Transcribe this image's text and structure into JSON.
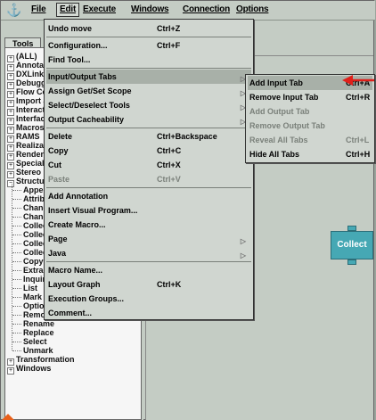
{
  "menubar": {
    "logo_icon": "anchor-icon",
    "items": [
      "File",
      "Edit",
      "Execute",
      "Windows",
      "Connection",
      "Options"
    ]
  },
  "left": {
    "tab": "Tools",
    "tree": [
      "(ALL)",
      "Annotation",
      "DXLink",
      "Debugging",
      "Flow Cont",
      "Import and",
      "Interactor",
      "Interface",
      "Macros",
      "RAMS",
      "Realization",
      "Rendering",
      "Special",
      "Stereo",
      "Structuring"
    ],
    "children": [
      "Append",
      "Attribute",
      "ChangeG",
      "ChangeG",
      "Collect",
      "CollectM",
      "CollectN",
      "CollectS",
      "CopyCon",
      "Extract",
      "Inquire",
      "List",
      "Mark",
      "Options",
      "Remove",
      "Rename",
      "Replace",
      "Select",
      "Unmark"
    ],
    "tree_bottom": [
      "Transformation",
      "Windows"
    ]
  },
  "edit_menu": {
    "items": [
      {
        "label": "Undo move",
        "acc": "Ctrl+Z"
      },
      {
        "label": "Configuration...",
        "acc": "Ctrl+F"
      },
      {
        "label": "Find Tool...",
        "acc": ""
      },
      {
        "label": "Input/Output Tabs",
        "acc": ""
      },
      {
        "label": "Assign Get/Set Scope",
        "acc": ""
      },
      {
        "label": "Select/Deselect Tools",
        "acc": ""
      },
      {
        "label": "Output Cacheability",
        "acc": ""
      },
      {
        "label": "Delete",
        "acc": "Ctrl+Backspace"
      },
      {
        "label": "Copy",
        "acc": "Ctrl+C"
      },
      {
        "label": "Cut",
        "acc": "Ctrl+X"
      },
      {
        "label": "Paste",
        "acc": "Ctrl+V"
      },
      {
        "label": "Add Annotation",
        "acc": ""
      },
      {
        "label": "Insert Visual Program...",
        "acc": ""
      },
      {
        "label": "Create Macro...",
        "acc": ""
      },
      {
        "label": "Page",
        "acc": ""
      },
      {
        "label": "Java",
        "acc": ""
      },
      {
        "label": "Macro Name...",
        "acc": ""
      },
      {
        "label": "Layout Graph",
        "acc": "Ctrl+K"
      },
      {
        "label": "Execution Groups...",
        "acc": ""
      },
      {
        "label": "Comment...",
        "acc": ""
      }
    ]
  },
  "submenu": {
    "items": [
      {
        "label": "Add Input Tab",
        "acc": "Ctrl+A"
      },
      {
        "label": "Remove Input Tab",
        "acc": "Ctrl+R"
      },
      {
        "label": "Add Output Tab",
        "acc": ""
      },
      {
        "label": "Remove Output Tab",
        "acc": ""
      },
      {
        "label": "Reveal All Tabs",
        "acc": "Ctrl+L"
      },
      {
        "label": "Hide All Tabs",
        "acc": "Ctrl+H"
      }
    ]
  },
  "canvas": {
    "node_label": "Collect"
  },
  "colors": {
    "menu_bg": "#d0d6d0",
    "node": "#46a8b4",
    "pointer": "#e0201a"
  }
}
